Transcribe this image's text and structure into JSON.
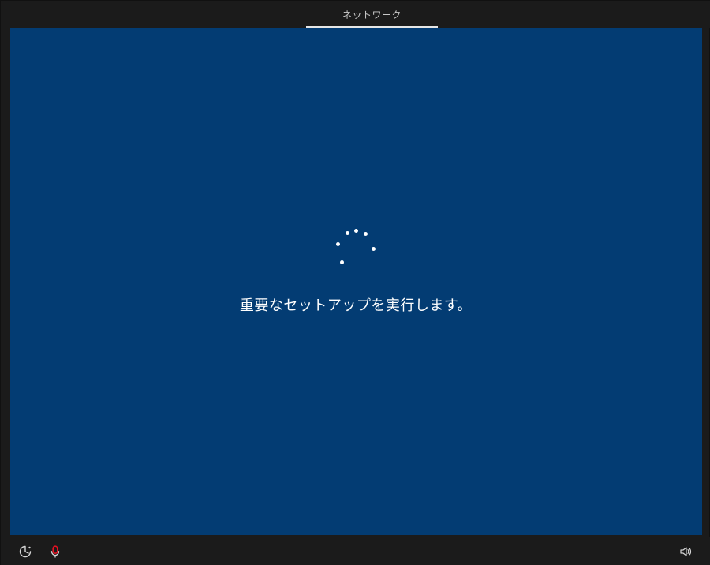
{
  "header": {
    "tab_label": "ネットワーク"
  },
  "main": {
    "status_text": "重要なセットアップを実行します。"
  },
  "footer": {
    "left_icons": [
      "ease-of-access-icon",
      "microphone-icon"
    ],
    "right_icons": [
      "volume-icon"
    ]
  },
  "colors": {
    "background_blue": "#033c73",
    "frame_dark": "#1b1b1b",
    "text_white": "#ffffff",
    "microphone_red": "#e81123"
  }
}
